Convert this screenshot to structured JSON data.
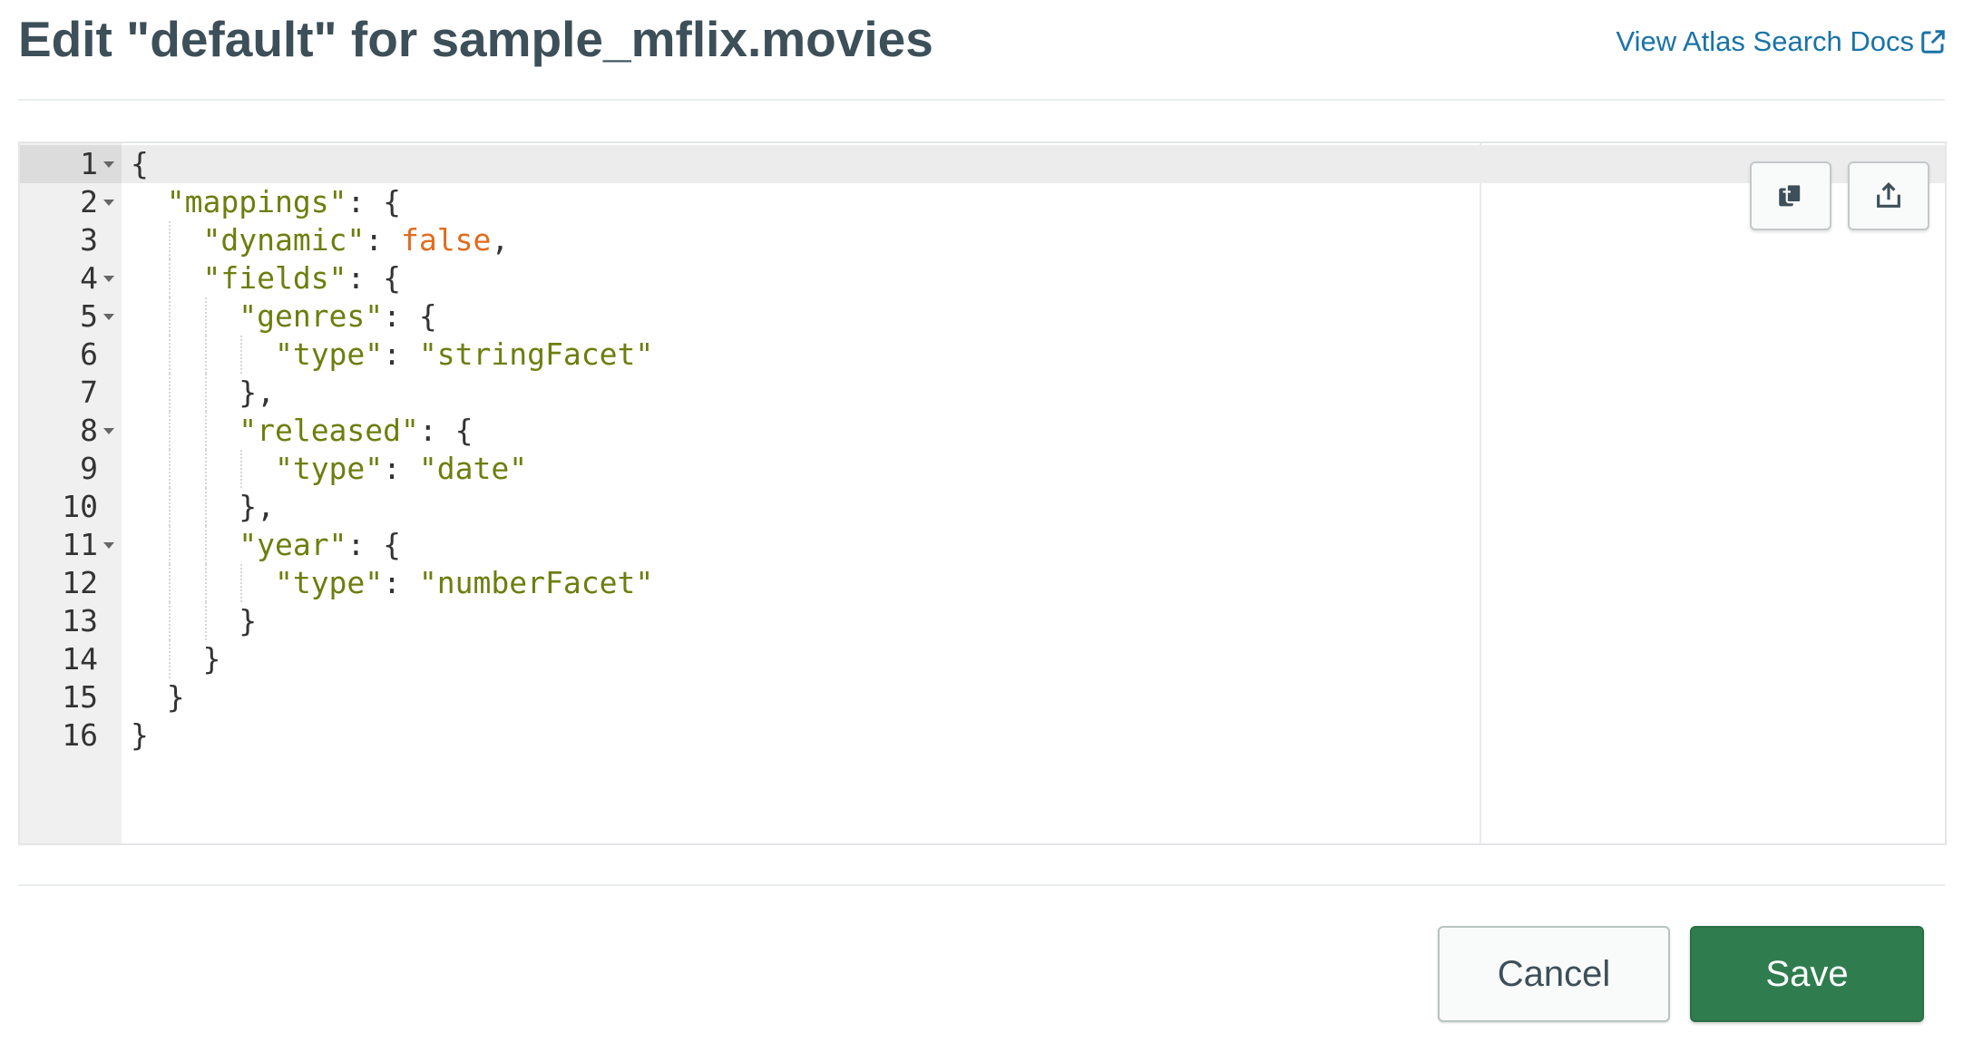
{
  "header": {
    "title": "Edit \"default\" for sample_mflix.movies",
    "docs_link_label": "View Atlas Search Docs"
  },
  "editor": {
    "language": "json",
    "lines": [
      {
        "num": "1",
        "foldable": true,
        "tokens": [
          {
            "t": "p",
            "v": "{"
          }
        ]
      },
      {
        "num": "2",
        "foldable": true,
        "tokens": [
          {
            "t": "p",
            "v": "  "
          },
          {
            "t": "str",
            "v": "\"mappings\""
          },
          {
            "t": "p",
            "v": ": {"
          }
        ]
      },
      {
        "num": "3",
        "foldable": false,
        "tokens": [
          {
            "t": "p",
            "v": "    "
          },
          {
            "t": "str",
            "v": "\"dynamic\""
          },
          {
            "t": "p",
            "v": ": "
          },
          {
            "t": "kw",
            "v": "false"
          },
          {
            "t": "p",
            "v": ","
          }
        ]
      },
      {
        "num": "4",
        "foldable": true,
        "tokens": [
          {
            "t": "p",
            "v": "    "
          },
          {
            "t": "str",
            "v": "\"fields\""
          },
          {
            "t": "p",
            "v": ": {"
          }
        ]
      },
      {
        "num": "5",
        "foldable": true,
        "tokens": [
          {
            "t": "p",
            "v": "      "
          },
          {
            "t": "str",
            "v": "\"genres\""
          },
          {
            "t": "p",
            "v": ": {"
          }
        ]
      },
      {
        "num": "6",
        "foldable": false,
        "tokens": [
          {
            "t": "p",
            "v": "        "
          },
          {
            "t": "str",
            "v": "\"type\""
          },
          {
            "t": "p",
            "v": ": "
          },
          {
            "t": "str",
            "v": "\"stringFacet\""
          }
        ]
      },
      {
        "num": "7",
        "foldable": false,
        "tokens": [
          {
            "t": "p",
            "v": "      },"
          }
        ]
      },
      {
        "num": "8",
        "foldable": true,
        "tokens": [
          {
            "t": "p",
            "v": "      "
          },
          {
            "t": "str",
            "v": "\"released\""
          },
          {
            "t": "p",
            "v": ": {"
          }
        ]
      },
      {
        "num": "9",
        "foldable": false,
        "tokens": [
          {
            "t": "p",
            "v": "        "
          },
          {
            "t": "str",
            "v": "\"type\""
          },
          {
            "t": "p",
            "v": ": "
          },
          {
            "t": "str",
            "v": "\"date\""
          }
        ]
      },
      {
        "num": "10",
        "foldable": false,
        "tokens": [
          {
            "t": "p",
            "v": "      },"
          }
        ]
      },
      {
        "num": "11",
        "foldable": true,
        "tokens": [
          {
            "t": "p",
            "v": "      "
          },
          {
            "t": "str",
            "v": "\"year\""
          },
          {
            "t": "p",
            "v": ": {"
          }
        ]
      },
      {
        "num": "12",
        "foldable": false,
        "tokens": [
          {
            "t": "p",
            "v": "        "
          },
          {
            "t": "str",
            "v": "\"type\""
          },
          {
            "t": "p",
            "v": ": "
          },
          {
            "t": "str",
            "v": "\"numberFacet\""
          }
        ]
      },
      {
        "num": "13",
        "foldable": false,
        "tokens": [
          {
            "t": "p",
            "v": "      }"
          }
        ]
      },
      {
        "num": "14",
        "foldable": false,
        "tokens": [
          {
            "t": "p",
            "v": "    }"
          }
        ]
      },
      {
        "num": "15",
        "foldable": false,
        "tokens": [
          {
            "t": "p",
            "v": "  }"
          }
        ]
      },
      {
        "num": "16",
        "foldable": false,
        "tokens": [
          {
            "t": "p",
            "v": "}"
          }
        ]
      }
    ],
    "toolbar": {
      "copy_icon": "copy-icon",
      "export_icon": "share-export-icon"
    }
  },
  "footer": {
    "cancel_label": "Cancel",
    "save_label": "Save"
  },
  "colors": {
    "title": "#3d4f58",
    "link": "#1a73a8",
    "json_string": "#6c7f0e",
    "json_keyword": "#e06c1e",
    "save_button": "#2f7d4e"
  }
}
